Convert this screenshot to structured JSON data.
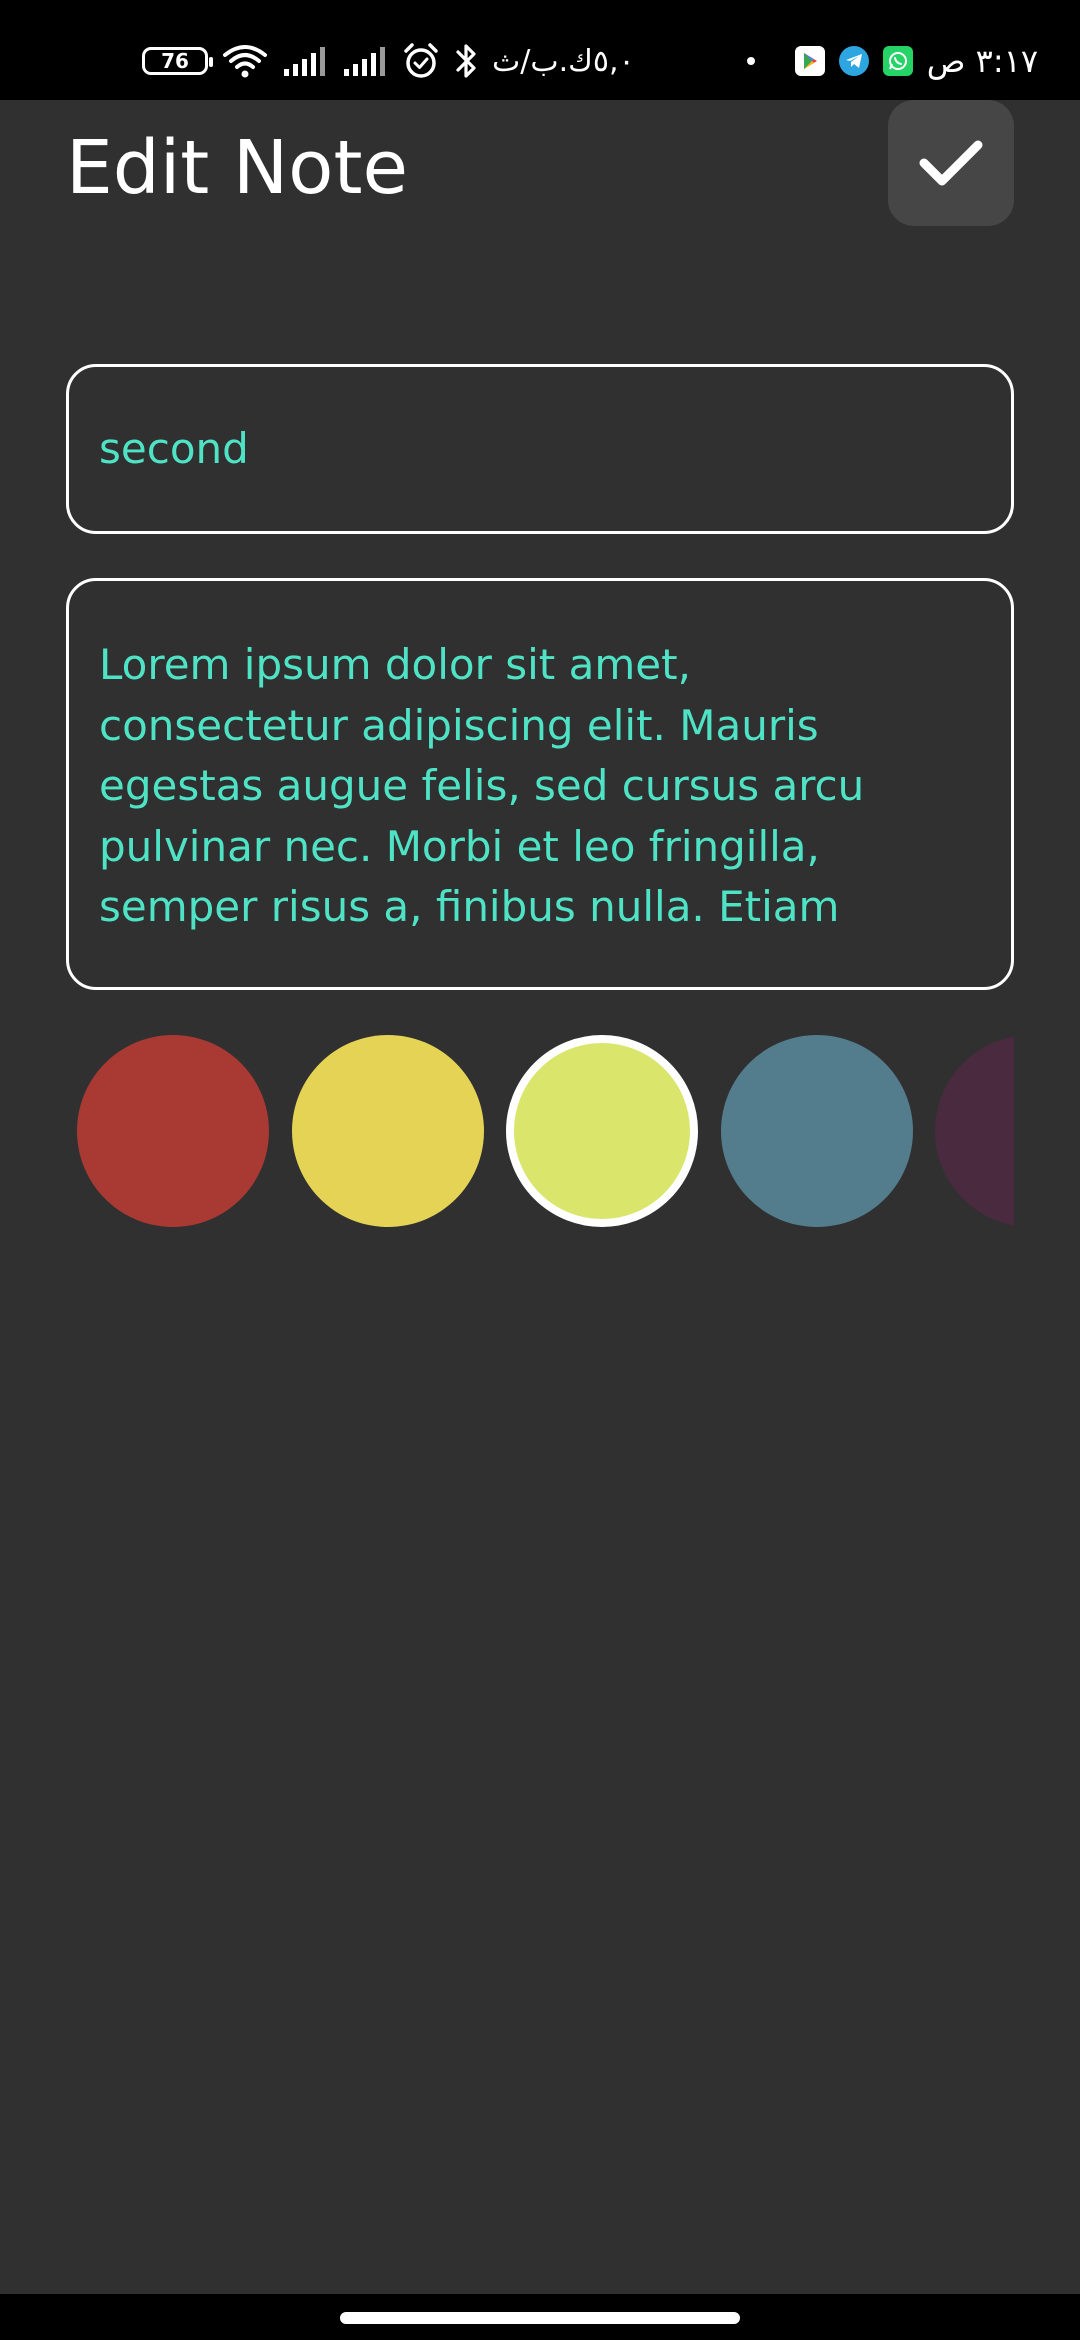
{
  "status_bar": {
    "battery_level": "76",
    "network_speed": "٥,٠ك.ب/ث",
    "time": "٣:١٧ ص",
    "notification_icons": [
      "play-store-icon",
      "telegram-icon",
      "whatsapp-icon"
    ]
  },
  "header": {
    "title": "Edit Note",
    "save_button_icon": "checkmark-icon"
  },
  "note": {
    "title_value": "second",
    "content_value": "Lorem ipsum dolor sit amet,\nconsectetur adipiscing elit. Mauris\negestas augue felis, sed cursus arcu\npulvinar nec. Morbi et leo fringilla,\nsemper risus a, finibus nulla. Etiam"
  },
  "colors": {
    "selected_index": 2,
    "swatches": [
      "#a93933",
      "#e5d356",
      "#dae56c",
      "#537c8c",
      "#4a2a3e"
    ]
  },
  "theme": {
    "background": "#303030",
    "accent_text": "#4fe3c6",
    "border": "#ffffff",
    "button_bg": "#464646"
  }
}
